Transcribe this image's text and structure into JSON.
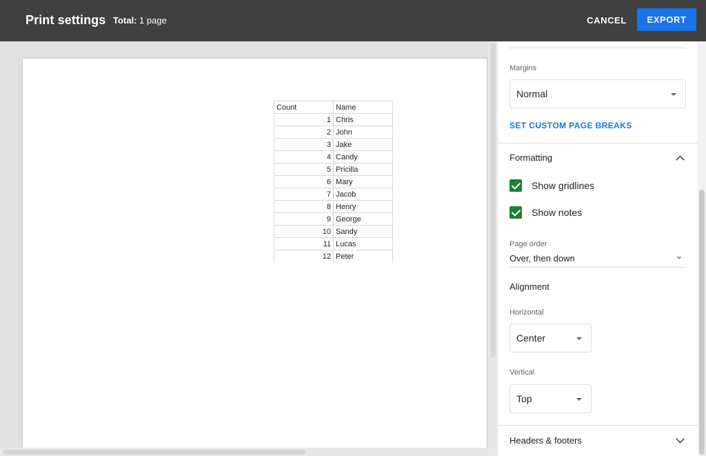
{
  "header": {
    "title": "Print settings",
    "total_label": "Total:",
    "total_value": "1 page",
    "cancel_label": "CANCEL",
    "export_label": "EXPORT"
  },
  "sheet": {
    "headers": [
      "Count",
      "Name"
    ],
    "rows": [
      [
        "1",
        "Chris"
      ],
      [
        "2",
        "John"
      ],
      [
        "3",
        "Jake"
      ],
      [
        "4",
        "Candy"
      ],
      [
        "5",
        "Pricilla"
      ],
      [
        "6",
        "Mary"
      ],
      [
        "7",
        "Jacob"
      ],
      [
        "8",
        "Henry"
      ],
      [
        "9",
        "George"
      ],
      [
        "10",
        "Sandy"
      ],
      [
        "11",
        "Lucas"
      ],
      [
        "12",
        "Peter"
      ]
    ]
  },
  "settings": {
    "margins_label": "Margins",
    "margins_value": "Normal",
    "custom_breaks_label": "SET CUSTOM PAGE BREAKS",
    "formatting": {
      "title": "Formatting",
      "show_gridlines_label": "Show gridlines",
      "show_gridlines_checked": true,
      "show_notes_label": "Show notes",
      "show_notes_checked": true,
      "page_order_label": "Page order",
      "page_order_value": "Over, then down",
      "alignment_title": "Alignment",
      "horizontal_label": "Horizontal",
      "horizontal_value": "Center",
      "vertical_label": "Vertical",
      "vertical_value": "Top"
    },
    "headers_footers_title": "Headers & footers"
  },
  "colors": {
    "topbar": "#404040",
    "accent": "#1a73e8",
    "checkbox": "#188038"
  },
  "icons": {
    "dropdown": "caret-down-icon",
    "collapse": "chevron-up-icon",
    "expand": "chevron-down-icon",
    "check": "checkmark-icon"
  }
}
